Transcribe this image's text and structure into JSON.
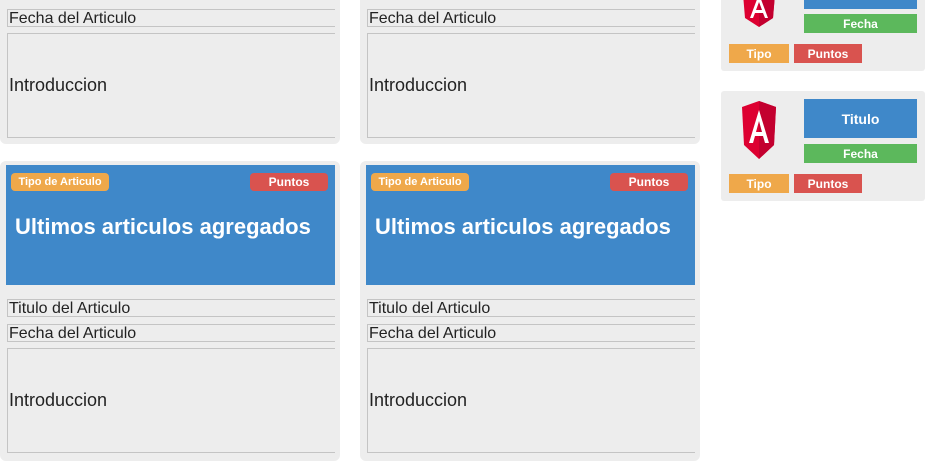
{
  "top_cards": [
    {
      "fecha": "Fecha del Articulo",
      "intro": "Introduccion"
    },
    {
      "fecha": "Fecha del Articulo",
      "intro": "Introduccion"
    }
  ],
  "main_cards": [
    {
      "tipo": "Tipo de Articulo",
      "puntos": "Puntos",
      "hero_title": "Ultimos articulos agregados",
      "titulo": "Titulo del Articulo",
      "fecha": "Fecha del Articulo",
      "intro": "Introduccion"
    },
    {
      "tipo": "Tipo de Articulo",
      "puntos": "Puntos",
      "hero_title": "Ultimos articulos agregados",
      "titulo": "Titulo del Articulo",
      "fecha": "Fecha del Articulo",
      "intro": "Introduccion"
    }
  ],
  "side_cards": [
    {
      "logo": "angular-logo-icon",
      "titulo": "",
      "fecha": "Fecha",
      "tipo": "Tipo",
      "puntos": "Puntos"
    },
    {
      "logo": "angular-logo-icon",
      "titulo": "Titulo",
      "fecha": "Fecha",
      "tipo": "Tipo",
      "puntos": "Puntos"
    }
  ],
  "colors": {
    "blue": "#3f88c9",
    "green": "#5cb85c",
    "orange": "#efa84a",
    "red": "#d9534f",
    "card_bg": "#ededed",
    "angular_red": "#dd0031",
    "angular_dark": "#c3002f"
  }
}
